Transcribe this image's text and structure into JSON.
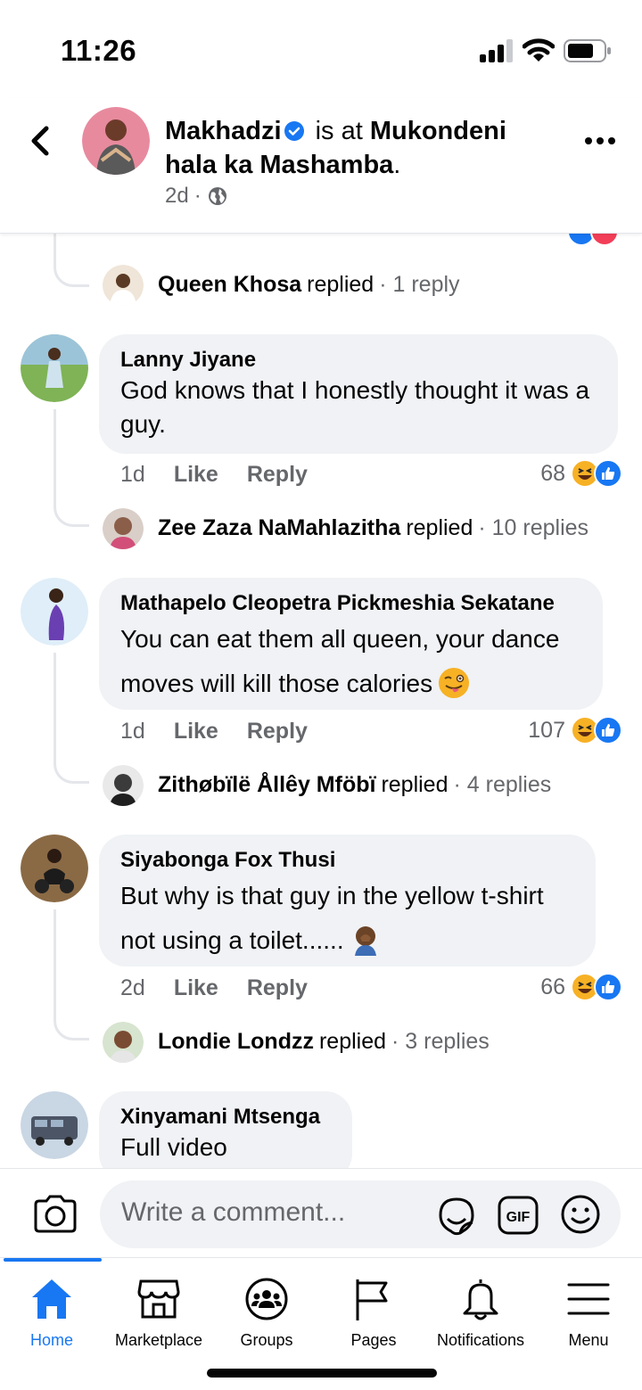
{
  "status_bar": {
    "time": "11:26"
  },
  "header": {
    "name": "Makhadzi",
    "is_at": "is at",
    "place": "Mukondeni hala ka Mashamba",
    "period": ".",
    "time": "2d",
    "dot": "·"
  },
  "top_reply": {
    "name": "Queen Khosa",
    "replied": "replied",
    "count": "· 1 reply"
  },
  "comments": [
    {
      "name": "Lanny Jiyane",
      "text": "God knows that I honestly thought it was a guy.",
      "time": "1d",
      "like": "Like",
      "reply": "Reply",
      "reactions": "68",
      "reply_summary": {
        "name": "Zee Zaza NaMahlazitha",
        "replied": "replied",
        "count": "· 10 replies"
      }
    },
    {
      "name": "Mathapelo Cleopetra Pickmeshia Sekatane",
      "text": "You can eat them all queen, your dance moves will kill those calories",
      "emoji": "winking-tongue-emoji",
      "time": "1d",
      "like": "Like",
      "reply": "Reply",
      "reactions": "107",
      "reply_summary": {
        "name": "Zithøbïlë Ållêy Mföbï",
        "replied": "replied",
        "count": "· 4 replies"
      }
    },
    {
      "name": "Siyabonga Fox Thusi",
      "text": "But why is that guy in the yellow t-shirt not using a toilet......",
      "emoji": "facepalm-emoji",
      "time": "2d",
      "like": "Like",
      "reply": "Reply",
      "reactions": "66",
      "reply_summary": {
        "name": "Londie Londzz",
        "replied": "replied",
        "count": "· 3 replies"
      }
    },
    {
      "name": "Xinyamani Mtsenga",
      "text": "Full video"
    }
  ],
  "composer": {
    "placeholder": "Write a comment..."
  },
  "nav": {
    "items": [
      {
        "label": "Home",
        "icon": "home-icon"
      },
      {
        "label": "Marketplace",
        "icon": "marketplace-icon"
      },
      {
        "label": "Groups",
        "icon": "groups-icon"
      },
      {
        "label": "Pages",
        "icon": "pages-flag-icon"
      },
      {
        "label": "Notifications",
        "icon": "bell-icon"
      },
      {
        "label": "Menu",
        "icon": "hamburger-menu-icon"
      }
    ]
  },
  "colors": {
    "accent": "#1877f2",
    "bubble": "#f0f2f5",
    "muted": "#65676b",
    "haha": "#f7b125",
    "love_red": "#f33e58"
  }
}
